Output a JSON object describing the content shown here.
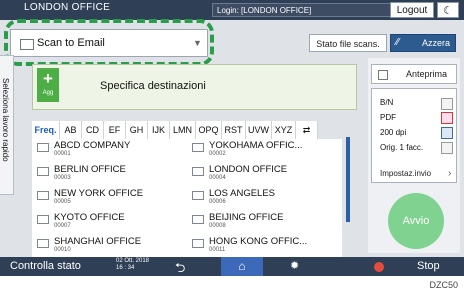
{
  "topbar": {
    "title": "LONDON OFFICE",
    "login": "Login: [LONDON OFFICE]",
    "help": "?",
    "logout": "Logout",
    "moon": "☾"
  },
  "mode_select": {
    "value": "Scan to Email",
    "caret": "▼"
  },
  "side_tab": "Seleziona lavoro rapido",
  "stato_btn": "Stato file scans.",
  "azzera_btn": "Azzera",
  "dest": {
    "plus": "+",
    "agg": "Agg",
    "label": "Specifica destinazioni"
  },
  "index_tabs": [
    "Freq.",
    "AB",
    "CD",
    "EF",
    "GH",
    "IJK",
    "LMN",
    "OPQ",
    "RST",
    "UVW",
    "XYZ",
    "⇄"
  ],
  "addresses": [
    {
      "name": "ABCD COMPANY",
      "number": "00001"
    },
    {
      "name": "YOKOHAMA OFFIC...",
      "number": "00002"
    },
    {
      "name": "BERLIN OFFICE",
      "number": "00003"
    },
    {
      "name": "LONDON OFFICE",
      "number": "00004"
    },
    {
      "name": "NEW YORK OFFICE",
      "number": "00005"
    },
    {
      "name": "LOS ANGELES",
      "number": "00006"
    },
    {
      "name": "KYOTO OFFICE",
      "number": "00007"
    },
    {
      "name": "BEIJING OFFICE",
      "number": "00008"
    },
    {
      "name": "SHANGHAI  OFFICE",
      "number": "00010"
    },
    {
      "name": "HONG KONG OFFIC...",
      "number": "00011"
    }
  ],
  "right_panel": {
    "preview": "Anteprima",
    "rows": [
      "B/N",
      "PDF",
      "200 dpi",
      "Orig. 1 facc."
    ],
    "impost": "Impostaz.invio",
    "avvio": "Avvio"
  },
  "bottombar": {
    "controlla": "Controlla stato",
    "date": "02 Ott. 2018",
    "time": "16 : 34",
    "stop": "Stop"
  },
  "caption": "DZC50",
  "colors": {
    "highlight": "#2a9d4a",
    "topbar": "#2f3f55",
    "accent": "#3d6ab8",
    "start": "#7fd28f"
  }
}
